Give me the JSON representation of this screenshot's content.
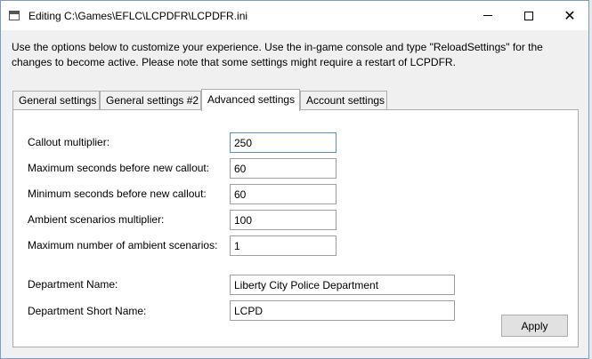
{
  "window": {
    "title": "Editing C:\\Games\\EFLC\\LCPDFR\\LCPDFR.ini"
  },
  "intro_text": "Use the options below to customize your experience. Use the in-game console and type \"ReloadSettings\" for the changes to become active. Please note that some settings might require a restart of LCPDFR.",
  "tabs": [
    {
      "label": "General settings"
    },
    {
      "label": "General settings #2"
    },
    {
      "label": "Advanced settings"
    },
    {
      "label": "Account settings"
    }
  ],
  "fields": [
    {
      "label": "Callout multiplier:",
      "value": "250"
    },
    {
      "label": "Maximum seconds before new callout:",
      "value": "60"
    },
    {
      "label": "Minimum seconds before new callout:",
      "value": "60"
    },
    {
      "label": "Ambient scenarios multiplier:",
      "value": "100"
    },
    {
      "label": "Maximum number of ambient scenarios:",
      "value": "1"
    },
    {
      "label": "Department Name:",
      "value": "Liberty City Police Department"
    },
    {
      "label": "Department Short Name:",
      "value": "LCPD"
    }
  ],
  "apply_label": "Apply"
}
